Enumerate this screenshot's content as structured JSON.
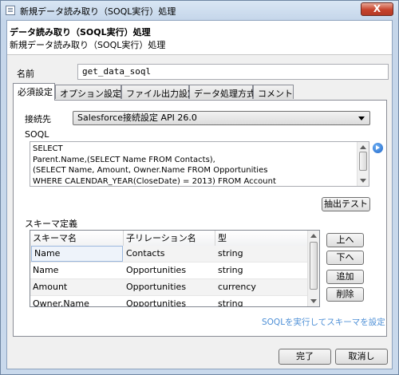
{
  "window": {
    "title": "新規データ読み取り（SOQL実行）処理",
    "close_label": "X"
  },
  "header": {
    "title": "データ読み取り（SOQL実行）処理",
    "subtitle": "新規データ読み取り（SOQL実行）処理"
  },
  "name": {
    "label": "名前",
    "value": "get_data_soql"
  },
  "tabs": [
    {
      "label": "必須設定",
      "active": true
    },
    {
      "label": "オプション設定"
    },
    {
      "label": "ファイル出力設定"
    },
    {
      "label": "データ処理方式"
    },
    {
      "label": "コメント"
    }
  ],
  "connection": {
    "label": "接続先",
    "value": "Salesforce接続設定 API 26.0"
  },
  "soql": {
    "label": "SOQL",
    "text": "SELECT\nParent.Name,(SELECT Name FROM Contacts),\n(SELECT Name, Amount, Owner.Name FROM Opportunities\nWHERE CALENDAR_YEAR(CloseDate) = 2013) FROM Account",
    "arrow_icon": "arrow-right-circle-icon"
  },
  "buttons": {
    "extract_test": "抽出テスト",
    "up": "上へ",
    "down": "下へ",
    "add": "追加",
    "delete": "削除",
    "ok": "完了",
    "cancel": "取消し"
  },
  "schema": {
    "label": "スキーマ定義",
    "columns": [
      "スキーマ名",
      "子リレーション名",
      "型"
    ],
    "rows": [
      [
        "Name",
        "Contacts",
        "string"
      ],
      [
        "Name",
        "Opportunities",
        "string"
      ],
      [
        "Amount",
        "Opportunities",
        "currency"
      ],
      [
        "Owner.Name",
        "Opportunities",
        "string"
      ]
    ]
  },
  "link_text": "SOQLを実行してスキーマを設定",
  "colors": {
    "link": "#4d8fd6",
    "close": "#c7432c",
    "selected_cell_border": "#9bb8de"
  }
}
